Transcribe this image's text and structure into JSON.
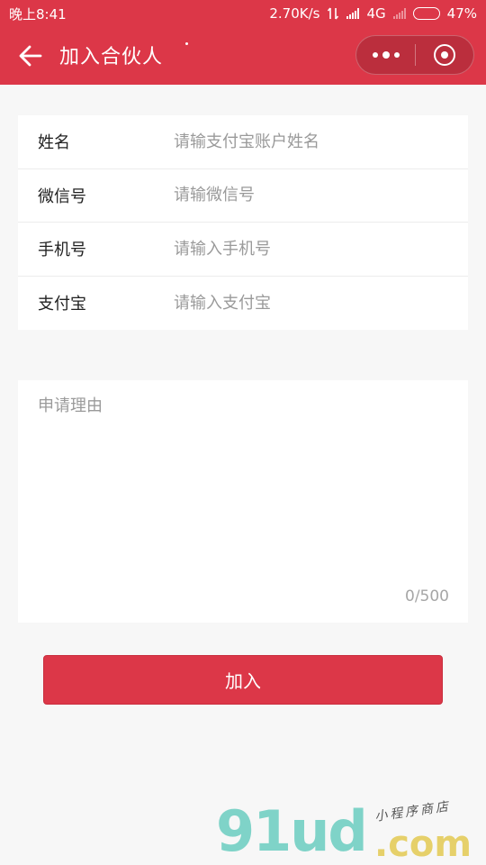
{
  "status_bar": {
    "time": "晚上8:41",
    "network_speed": "2.70K/s",
    "network_type": "4G",
    "battery_level": 47,
    "battery_text": "47%"
  },
  "nav_bar": {
    "title": "加入合伙人",
    "background_color": "#dc3748"
  },
  "form": {
    "fields": [
      {
        "label": "姓名",
        "placeholder": "请输支付宝账户姓名",
        "value": ""
      },
      {
        "label": "微信号",
        "placeholder": "请输微信号",
        "value": ""
      },
      {
        "label": "手机号",
        "placeholder": "请输入手机号",
        "value": ""
      },
      {
        "label": "支付宝",
        "placeholder": "请输入支付宝",
        "value": ""
      }
    ],
    "reason": {
      "placeholder": "申请理由",
      "value": "",
      "counter": "0/500"
    },
    "submit_label": "加入"
  },
  "watermark": {
    "brand": "91ud",
    "suffix": ".com",
    "slogan": "小程序商店"
  }
}
